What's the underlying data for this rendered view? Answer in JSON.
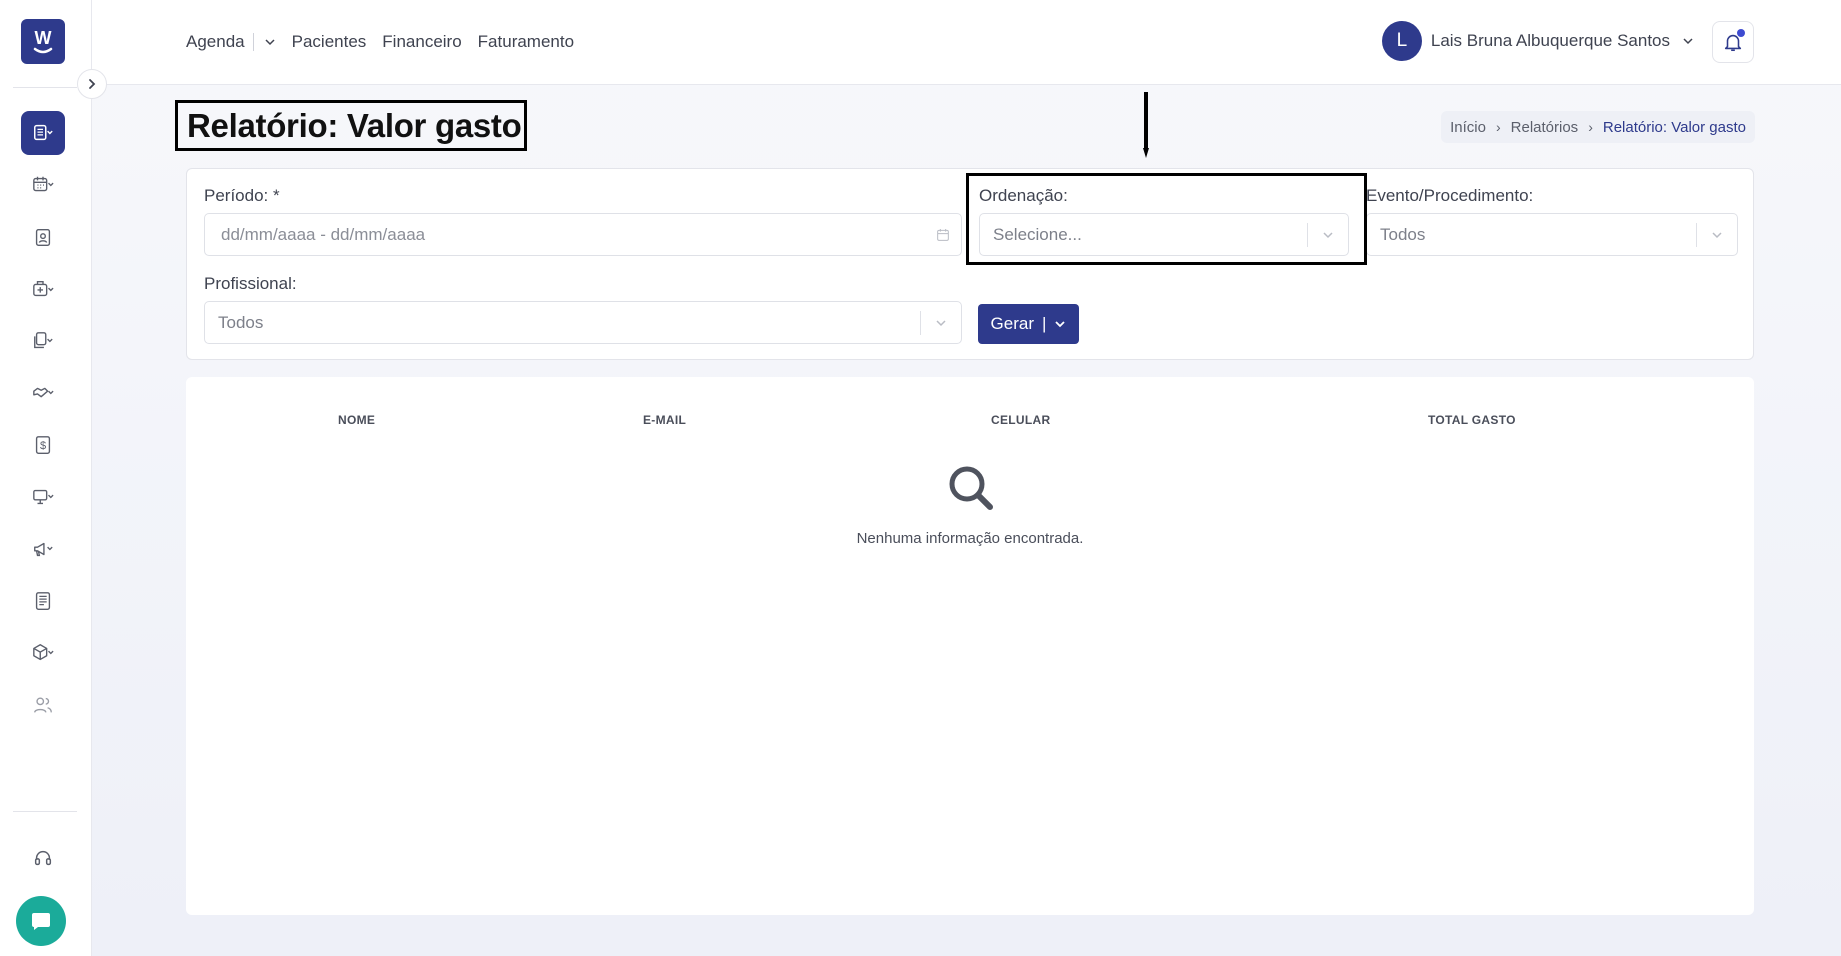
{
  "app": {
    "logo_letter": "W"
  },
  "nav": {
    "items": [
      "Agenda",
      "Pacientes",
      "Financeiro",
      "Faturamento"
    ]
  },
  "user": {
    "initial": "L",
    "name": "Lais Bruna Albuquerque Santos"
  },
  "page": {
    "title": "Relatório: Valor gasto",
    "breadcrumb": [
      "Início",
      "Relatórios",
      "Relatório: Valor gasto"
    ]
  },
  "filters": {
    "periodo": {
      "label": "Período: *",
      "placeholder": "dd/mm/aaaa - dd/mm/aaaa"
    },
    "ordenacao": {
      "label": "Ordenação:",
      "value": "Selecione..."
    },
    "evento": {
      "label": "Evento/Procedimento:",
      "value": "Todos"
    },
    "profissional": {
      "label": "Profissional:",
      "value": "Todos"
    },
    "gerar_label": "Gerar"
  },
  "table": {
    "columns": [
      "NOME",
      "E-MAIL",
      "CELULAR",
      "TOTAL GASTO"
    ],
    "empty_message": "Nenhuma informação encontrada."
  },
  "sidebar": {
    "items": [
      "reports-icon",
      "calendar-icon",
      "patient-card-icon",
      "clinic-icon",
      "documents-icon",
      "handshake-icon",
      "dollar-icon",
      "monitor-icon",
      "megaphone-icon",
      "newspaper-icon",
      "box-icon",
      "users-icon"
    ],
    "bottom": [
      "headset-icon",
      "chat-icon"
    ]
  },
  "colors": {
    "primary": "#2e3a8c",
    "chat": "#1bab9a"
  }
}
